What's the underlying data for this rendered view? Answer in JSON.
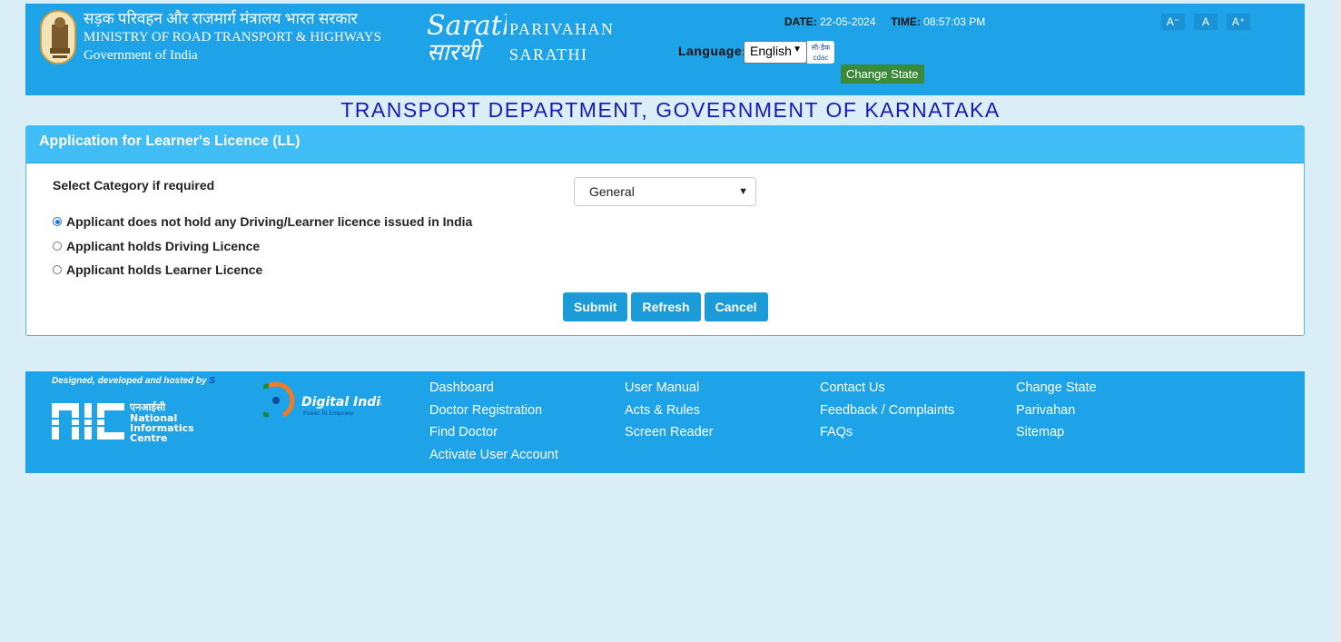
{
  "header": {
    "ministry_hindi": "सड़क परिवहन और राजमार्ग मंत्रालय भारत सरकार",
    "ministry_english": "MINISTRY OF ROAD TRANSPORT & HIGHWAYS",
    "government": "Government of India",
    "brand_line1": "PARIVAHAN",
    "brand_line2": "SARATHI",
    "date_label": "DATE:",
    "date_value": "22-05-2024",
    "time_label": "TIME:",
    "time_value": "08:57:03 PM",
    "language_label": "Language:",
    "language_value": "English",
    "cdac_logo_text": "सी-डैक cdac",
    "change_state": "Change State",
    "font_decrease": "A⁻",
    "font_normal": "A",
    "font_increase": "A⁺"
  },
  "department_title": "TRANSPORT DEPARTMENT, GOVERNMENT OF KARNATAKA",
  "form": {
    "panel_title": "Application for Learner's Licence (LL)",
    "category_label": "Select Category if required",
    "category_value": "General",
    "options": [
      {
        "label": "Applicant does not hold any Driving/Learner licence issued in India",
        "checked": true
      },
      {
        "label": "Applicant holds Driving Licence",
        "checked": false
      },
      {
        "label": "Applicant holds Learner Licence",
        "checked": false
      }
    ],
    "submit": "Submit",
    "refresh": "Refresh",
    "cancel": "Cancel"
  },
  "footer": {
    "designed_text": "Designed, developed and hosted by",
    "designed_suffix": "S",
    "nic_logo_text": "एनआईसी National Informatics Centre",
    "digital_india_logo_text": "Digital India",
    "col1": [
      "Dashboard",
      "Doctor Registration",
      "Find Doctor",
      "Activate User Account"
    ],
    "col2": [
      "User Manual",
      "Acts & Rules",
      "Screen Reader"
    ],
    "col3": [
      "Contact Us",
      "Feedback / Complaints",
      "FAQs"
    ],
    "col4": [
      "Change State",
      "Parivahan",
      "Sitemap"
    ]
  },
  "colors": {
    "header_bg": "#1ea3e8",
    "panel_head": "#40bdf5",
    "title": "#1a1ab8",
    "button": "#1b9bd8",
    "change_state_btn": "#3b8a3a",
    "page_bg": "#d9eef6"
  }
}
